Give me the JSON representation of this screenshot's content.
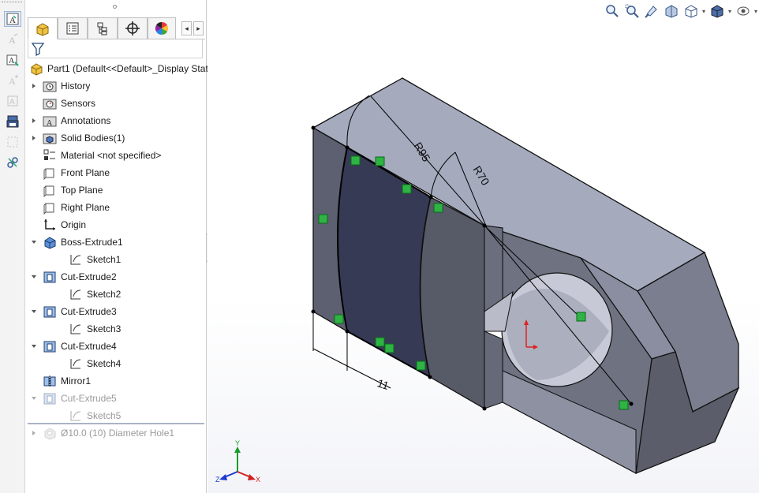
{
  "tabs": [
    {
      "name": "featuremanager",
      "icon": "part-tree-icon"
    },
    {
      "name": "propertymanager",
      "icon": "property-list-icon"
    },
    {
      "name": "configurationmanager",
      "icon": "configuration-icon"
    },
    {
      "name": "dimxpertmanager",
      "icon": "crosshair-icon"
    },
    {
      "name": "displaymanager",
      "icon": "color-wheel-icon"
    }
  ],
  "tree": {
    "root": "Part1  (Default<<Default>_Display Stat",
    "items": [
      {
        "label": "History",
        "icon": "history-folder-icon",
        "toggle": "collapsed"
      },
      {
        "label": "Sensors",
        "icon": "sensor-folder-icon",
        "toggle": "none"
      },
      {
        "label": "Annotations",
        "icon": "annotation-folder-icon",
        "toggle": "collapsed"
      },
      {
        "label": "Solid Bodies(1)",
        "icon": "solid-bodies-folder-icon",
        "toggle": "collapsed"
      },
      {
        "label": "Material <not specified>",
        "icon": "material-icon",
        "toggle": "none"
      },
      {
        "label": "Front Plane",
        "icon": "plane-icon",
        "toggle": "none"
      },
      {
        "label": "Top Plane",
        "icon": "plane-icon",
        "toggle": "none"
      },
      {
        "label": "Right Plane",
        "icon": "plane-icon",
        "toggle": "none"
      },
      {
        "label": "Origin",
        "icon": "origin-icon",
        "toggle": "none"
      },
      {
        "label": "Boss-Extrude1",
        "icon": "boss-extrude-icon",
        "toggle": "expanded"
      },
      {
        "label": "Sketch1",
        "icon": "sketch-icon",
        "toggle": "child"
      },
      {
        "label": "Cut-Extrude2",
        "icon": "cut-extrude-icon",
        "toggle": "expanded"
      },
      {
        "label": "Sketch2",
        "icon": "sketch-icon",
        "toggle": "child"
      },
      {
        "label": "Cut-Extrude3",
        "icon": "cut-extrude-icon",
        "toggle": "expanded"
      },
      {
        "label": "Sketch3",
        "icon": "sketch-icon",
        "toggle": "child"
      },
      {
        "label": "Cut-Extrude4",
        "icon": "cut-extrude-icon",
        "toggle": "expanded"
      },
      {
        "label": "Sketch4",
        "icon": "sketch-icon",
        "toggle": "child"
      },
      {
        "label": "Mirror1",
        "icon": "mirror-icon",
        "toggle": "none"
      },
      {
        "label": "Cut-Extrude5",
        "icon": "cut-extrude-icon",
        "toggle": "expanded",
        "suppressed": true
      },
      {
        "label": "Sketch5",
        "icon": "sketch-icon",
        "toggle": "child",
        "suppressed": true
      },
      {
        "label": "Ø10.0 (10) Diameter Hole1",
        "icon": "hole-wizard-icon",
        "toggle": "collapsed",
        "suppressed": true
      }
    ]
  },
  "dimensions": {
    "r95": "R95",
    "r70": "R70",
    "width": "11"
  },
  "view_toolbar": [
    "zoom-to-fit-icon",
    "zoom-to-area-icon",
    "previous-view-icon",
    "section-view-icon",
    "view-orientation-icon",
    "display-style-icon",
    "hide-show-items-icon"
  ],
  "triad": {
    "x": "X",
    "y": "Y",
    "z": "Z"
  },
  "colors": {
    "part_face_top": "#a4a9bb",
    "part_face_side": "#6b6e7c",
    "part_face_dark": "#585b67",
    "part_face_selected": "#373a54",
    "relation_marker": "#2fb344",
    "origin_arrow": "#e02020"
  }
}
